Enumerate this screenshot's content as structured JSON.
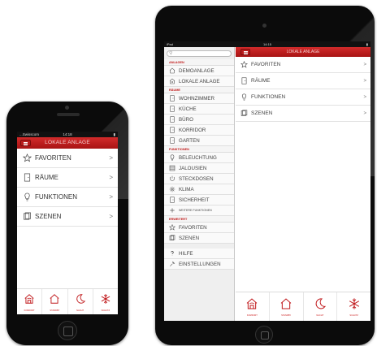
{
  "colors": {
    "accent": "#c0181b",
    "header_gradient_top": "#d32b2b",
    "header_gradient_bottom": "#a81414"
  },
  "phone": {
    "status": {
      "carrier": "...Swisscom",
      "time": "14:18"
    },
    "header": {
      "title": "LOKALE ANLAGE"
    },
    "list": [
      {
        "icon": "star-icon",
        "label": "FAVORITEN",
        "chevron": ">"
      },
      {
        "icon": "door-icon",
        "label": "RÄUME",
        "chevron": ">"
      },
      {
        "icon": "bulb-icon",
        "label": "FUNKTIONEN",
        "chevron": ">"
      },
      {
        "icon": "scene-icon",
        "label": "SZENEN",
        "chevron": ">"
      }
    ],
    "tabs": [
      {
        "icon": "comfort-home-icon",
        "label": "KOMFORT"
      },
      {
        "icon": "standby-home-icon",
        "label": "STANDBY"
      },
      {
        "icon": "moon-icon",
        "label": "NACHT"
      },
      {
        "icon": "snowflake-icon",
        "label": "SCHUTZ"
      }
    ]
  },
  "tablet": {
    "status": {
      "device": "iPad",
      "time": "14:15"
    },
    "header": {
      "title": "LOKALE ANLAGE"
    },
    "sidebar": {
      "anlagen_header": "ANLAGEN",
      "anlagen": [
        "DEMOANLAGE",
        "LOKALE ANLAGE"
      ],
      "raeume_header": "RÄUME",
      "raeume": [
        "WOHNZIMMER",
        "KÜCHE",
        "BÜRO",
        "KORRIDOR",
        "GARTEN"
      ],
      "funktionen_header": "FUNKTIONEN",
      "funktionen": [
        "BELEUCHTUNG",
        "JALOUSIEN",
        "STECKDOSEN",
        "KLIMA",
        "SICHERHEIT",
        "WEITERE FUNKTIONEN"
      ],
      "erweitert_header": "ERWEITERT",
      "erweitert": [
        "FAVORITEN",
        "SZENEN"
      ],
      "footer": [
        "HILFE",
        "EINSTELLUNGEN"
      ]
    },
    "list": [
      {
        "label": "FAVORITEN",
        "chevron": ">"
      },
      {
        "label": "RÄUME",
        "chevron": ">"
      },
      {
        "label": "FUNKTIONEN",
        "chevron": ">"
      },
      {
        "label": "SZENEN",
        "chevron": ">"
      }
    ],
    "tabs": [
      {
        "label": "KOMFORT"
      },
      {
        "label": "STANDBY"
      },
      {
        "label": "NACHT"
      },
      {
        "label": "SCHUTZ"
      }
    ]
  }
}
